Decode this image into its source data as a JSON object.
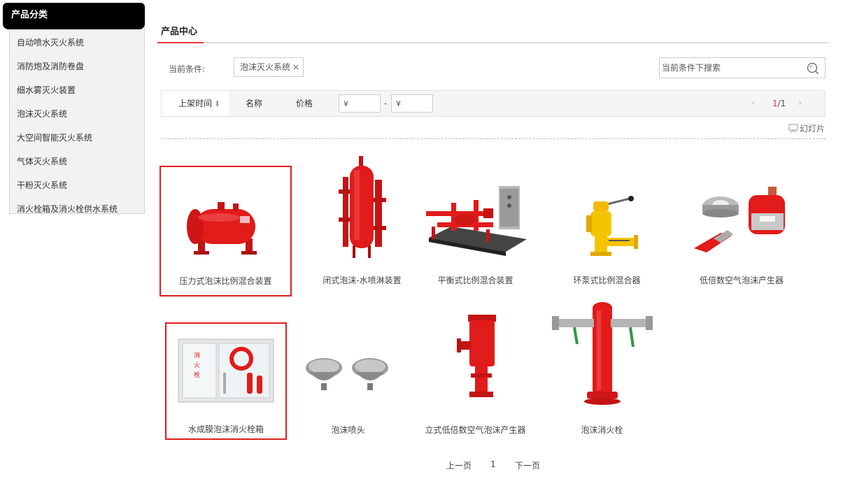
{
  "sidebar": {
    "title": "产品分类",
    "items": [
      {
        "label": "自动喷水灭火系统"
      },
      {
        "label": "消防炮及消防卷盘"
      },
      {
        "label": "细水雾灭火装置"
      },
      {
        "label": "泡沫灭火系统"
      },
      {
        "label": "大空间智能灭火系统"
      },
      {
        "label": "气体灭火系统"
      },
      {
        "label": "干粉灭火系统"
      },
      {
        "label": "消火栓箱及消火栓供水系统"
      }
    ]
  },
  "main": {
    "title": "产品中心",
    "current_condition_label": "当前条件:",
    "condition_tag": "泡沫灭火系统",
    "condition_remove": "×",
    "search_placeholder": "当前条件下搜索",
    "sort": {
      "time": "上架时间",
      "time_arrow": "⬇",
      "name": "名称",
      "price": "价格"
    },
    "price_min_placeholder": "¥",
    "price_max_placeholder": "¥",
    "price_dash": "-",
    "pager": {
      "prev": "‹",
      "current": "1",
      "total": "/1",
      "next": "›"
    },
    "slideshow": "幻灯片"
  },
  "products": [
    {
      "name": "压力式泡沫比例混合装置",
      "icon": "pressure-tank-icon"
    },
    {
      "name": "闭式泡沫-水喷淋装置",
      "icon": "vertical-tank-icon"
    },
    {
      "name": "平衡式比例混合装置",
      "icon": "skid-mixer-icon"
    },
    {
      "name": "环泵式比例混合器",
      "icon": "yellow-valve-icon"
    },
    {
      "name": "低倍数空气泡沫产生器",
      "icon": "foam-generator-icon"
    },
    {
      "name": "水成膜泡沫消火栓箱",
      "icon": "hydrant-cabinet-icon"
    },
    {
      "name": "泡沫喷头",
      "icon": "foam-nozzle-icon"
    },
    {
      "name": "立式低倍数空气泡沫产生器",
      "icon": "vertical-generator-icon"
    },
    {
      "name": "泡沫消火栓",
      "icon": "foam-hydrant-icon"
    }
  ],
  "bottom_pagination": {
    "prev": "上一页",
    "page": "1",
    "next": "下一页"
  },
  "colors": {
    "accent": "#e4393c",
    "highlight_border": "#e01d1d",
    "product_red": "#e21b1b"
  }
}
